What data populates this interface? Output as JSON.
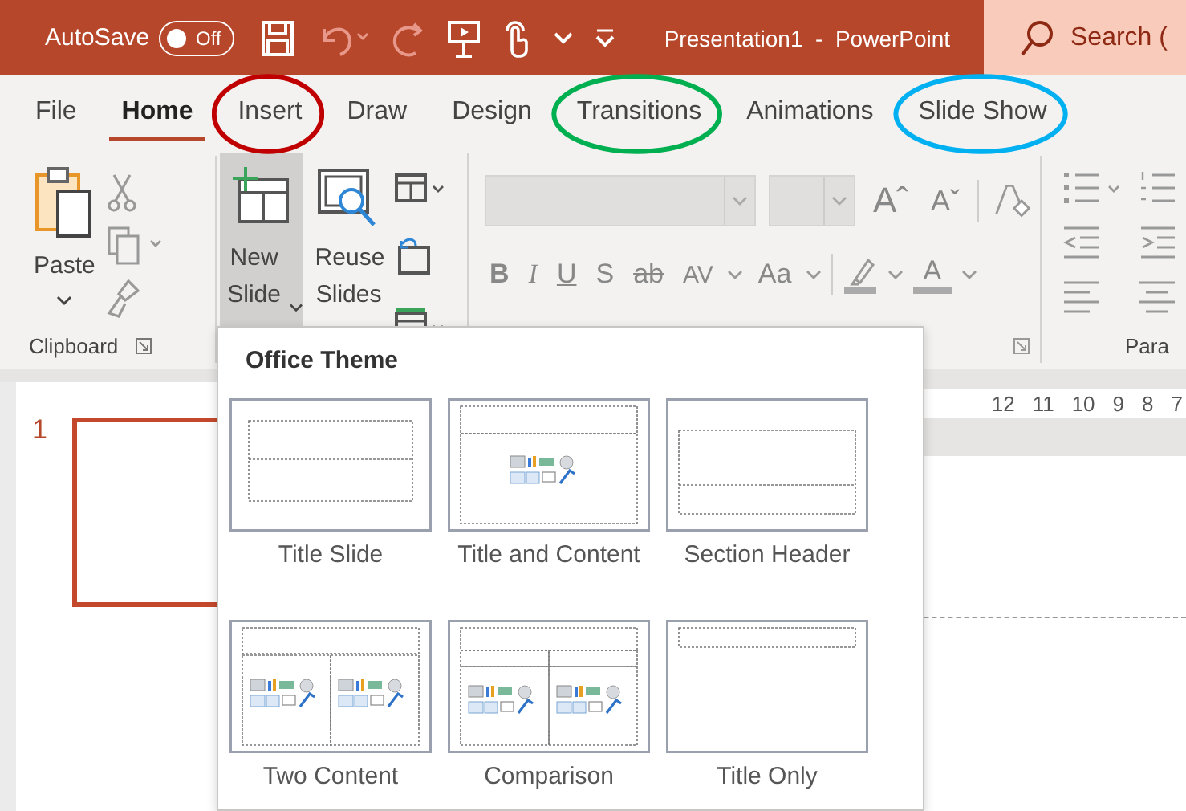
{
  "title_bar": {
    "autosave_label": "AutoSave",
    "autosave_toggle": {
      "label": "Off",
      "on": false
    },
    "title": "Presentation1  -  PowerPoint",
    "search": {
      "placeholder": "Search ("
    }
  },
  "tabs": [
    {
      "label": "File",
      "selected": false
    },
    {
      "label": "Home",
      "selected": true
    },
    {
      "label": "Insert",
      "selected": false,
      "color": "#c00000"
    },
    {
      "label": "Draw",
      "selected": false
    },
    {
      "label": "Design",
      "selected": false
    },
    {
      "label": "Transitions",
      "selected": false,
      "color": "#00b050"
    },
    {
      "label": "Animations",
      "selected": false
    },
    {
      "label": "Slide Show",
      "selected": false,
      "color": "#00b0f0"
    }
  ],
  "ribbon": {
    "clipboard": {
      "paste_label": "Paste",
      "group_label": "Clipboard"
    },
    "slides": {
      "new_slide": {
        "label": "New Slide",
        "pressed": true
      },
      "reuse_slides": {
        "label": "Reuse Slides"
      }
    },
    "font": {
      "grow_label": "Aˆ",
      "shrink_label": "Aˇ",
      "style_buttons": [
        "B",
        "I",
        "U",
        "S",
        "ab"
      ],
      "spacing_label": "AV",
      "case_label": "Aa",
      "color_label": "A"
    },
    "paragraph": {
      "group_label": "Para"
    }
  },
  "ruler": [
    "12",
    "11",
    "10",
    "9",
    "8",
    "7"
  ],
  "slide_pane": {
    "number": "1"
  },
  "layout_gallery": {
    "title": "Office Theme",
    "layouts": [
      {
        "kind": "title-slide",
        "label": "Title Slide"
      },
      {
        "kind": "title-content",
        "label": "Title and Content"
      },
      {
        "kind": "section-header",
        "label": "Section Header"
      },
      {
        "kind": "two-content",
        "label": "Two Content"
      },
      {
        "kind": "comparison",
        "label": "Comparison"
      },
      {
        "kind": "title-only",
        "label": "Title Only"
      }
    ]
  }
}
